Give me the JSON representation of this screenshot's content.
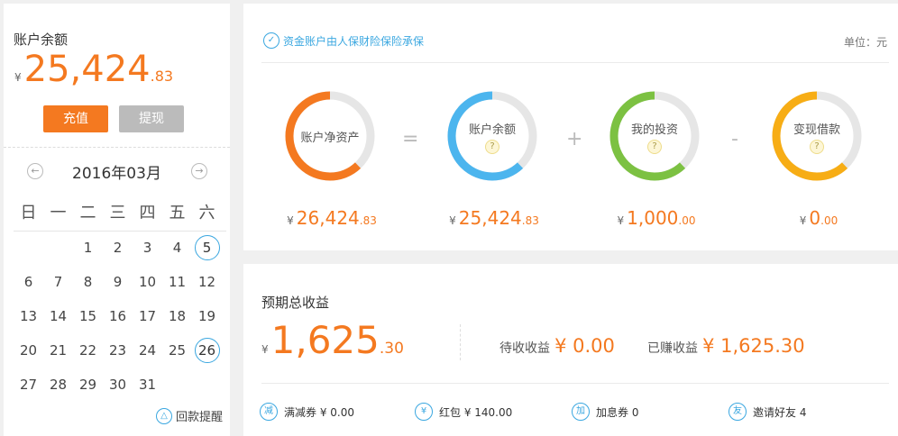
{
  "balance": {
    "label": "账户余额",
    "currency": "¥",
    "integer": "25,424",
    "decimal": ".83"
  },
  "actions": {
    "recharge": "充值",
    "withdraw": "提现"
  },
  "calendar": {
    "prev_icon": "chevron-left-icon",
    "next_icon": "chevron-right-icon",
    "month": "2016年03月",
    "weekdays": [
      "日",
      "一",
      "二",
      "三",
      "四",
      "五",
      "六"
    ],
    "weeks": [
      [
        "",
        "",
        "",
        "1",
        "2",
        "3",
        "4",
        "5"
      ],
      [
        "6",
        "7",
        "8",
        "9",
        "10",
        "11",
        "12"
      ],
      [
        "13",
        "14",
        "15",
        "16",
        "17",
        "18",
        "19"
      ],
      [
        "20",
        "21",
        "22",
        "23",
        "24",
        "25",
        "26"
      ],
      [
        "27",
        "28",
        "29",
        "30",
        "31",
        "",
        ""
      ]
    ],
    "marked_days": [
      "5",
      "26"
    ],
    "reminder": "回款提醒"
  },
  "assets": {
    "insurance": "资金账户由人保财险保险承保",
    "unit": "单位：元",
    "operators": [
      "=",
      "+",
      "-"
    ],
    "rings": [
      {
        "label": "账户净资产",
        "currency": "¥",
        "integer": "26,424",
        "decimal": ".83",
        "color": "#f47920",
        "fraction": 0.62,
        "help": false
      },
      {
        "label": "账户余额",
        "currency": "¥",
        "integer": "25,424",
        "decimal": ".83",
        "color": "#4cb5ee",
        "fraction": 0.62,
        "help": true
      },
      {
        "label": "我的投资",
        "currency": "¥",
        "integer": "1,000",
        "decimal": ".00",
        "color": "#7cc142",
        "fraction": 0.62,
        "help": true
      },
      {
        "label": "变现借款",
        "currency": "¥",
        "integer": "0",
        "decimal": ".00",
        "color": "#f7ad15",
        "fraction": 0.62,
        "help": true
      }
    ]
  },
  "earnings": {
    "title": "预期总收益",
    "currency": "¥",
    "integer": "1,625",
    "decimal": ".30",
    "pending_label": "待收收益",
    "pending_value": "¥ 0.00",
    "earned_label": "已赚收益",
    "earned_value": "¥ 1,625.30"
  },
  "coupons": [
    {
      "icon": "减",
      "text": "满减券 ¥ 0.00"
    },
    {
      "icon": "¥",
      "text": "红包 ¥ 140.00"
    },
    {
      "icon": "加",
      "text": "加息券 0"
    },
    {
      "icon": "友",
      "text": "邀请好友 4"
    }
  ],
  "colors": {
    "accent": "#f47920",
    "link": "#3aa7e0",
    "muted_button": "#bbbbbb"
  }
}
